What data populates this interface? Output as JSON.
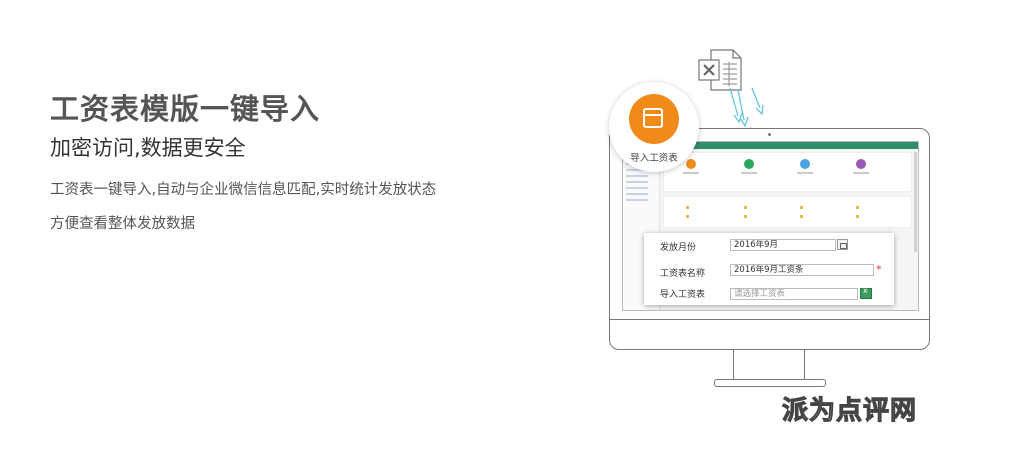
{
  "hero": {
    "title": "工资表模版一键导入",
    "subtitle": "加密访问,数据更安全",
    "line1": "工资表一键导入,自动与企业微信信息匹配,实时统计发放状态",
    "line2": "方便查看整体发放数据"
  },
  "badge": {
    "label": "导入工资表",
    "icon": "calendar-icon",
    "color": "#f08a18"
  },
  "form": {
    "month_label": "发放月份",
    "month_value": "2016年9月",
    "name_label": "工资表名称",
    "name_value": "2016年9月工资条",
    "required_mark": "*",
    "import_label": "导入工资表",
    "import_placeholder": "请选择工资表"
  },
  "screen_apps": [
    {
      "color": "#f08a18"
    },
    {
      "color": "#2aa85a"
    },
    {
      "color": "#4aa3e0"
    },
    {
      "color": "#9b59b6"
    }
  ],
  "watermark": "派为点评网"
}
